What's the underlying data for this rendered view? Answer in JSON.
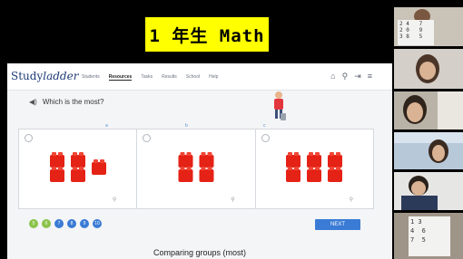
{
  "banner": {
    "text": "1 年生 Math"
  },
  "app": {
    "logo_main": "Study",
    "logo_italic": "ladder",
    "nav": [
      "Students",
      "Resources",
      "Tasks",
      "Results",
      "School",
      "Help"
    ],
    "active_nav": "Resources",
    "icons": [
      "home-icon",
      "search-icon",
      "logout-icon",
      "menu-icon"
    ]
  },
  "question": {
    "text": "Which is the most?"
  },
  "columns": [
    "a",
    "b",
    "c"
  ],
  "choices": [
    {
      "brick_count": 5
    },
    {
      "brick_count": 4
    },
    {
      "brick_count": 6
    }
  ],
  "pagination": [
    "5",
    "6",
    "7",
    "8",
    "9",
    "10"
  ],
  "next_label": "NEXT",
  "caption": "Comparing groups (most)",
  "participant_notes": [
    "2 4   7\n2 0   9\n3 8   5",
    "1 3\n4  6\n7  5"
  ],
  "colors": {
    "banner": "#ffff00",
    "brick": "#e52216",
    "next": "#3a7bd5",
    "page_done": "#8bc34a",
    "page_todo": "#3a7bd5"
  }
}
